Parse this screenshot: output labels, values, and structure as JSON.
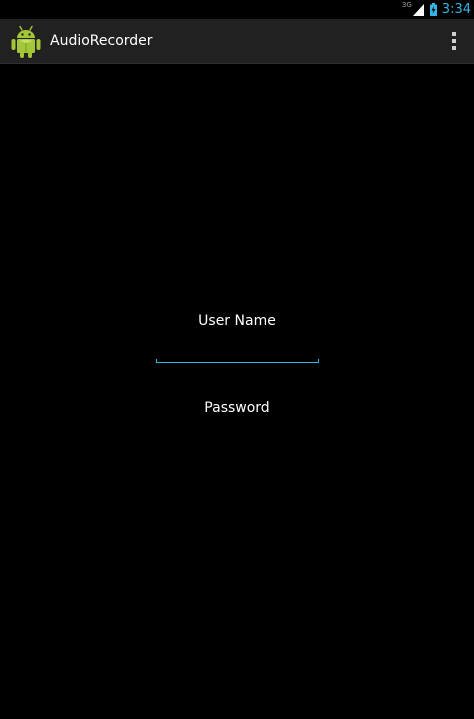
{
  "status_bar": {
    "network_type": "3G",
    "clock": "3:34",
    "accent_color": "#33b5e5",
    "icons": [
      "signal-icon",
      "battery-icon"
    ]
  },
  "action_bar": {
    "title": "AudioRecorder",
    "app_icon": "android-robot-icon",
    "overflow_icon": "overflow-menu-icon",
    "background_color": "#212121"
  },
  "form": {
    "username_label": "User Name",
    "username_value": "",
    "password_label": "Password",
    "field_accent_color": "#33b5e5"
  }
}
